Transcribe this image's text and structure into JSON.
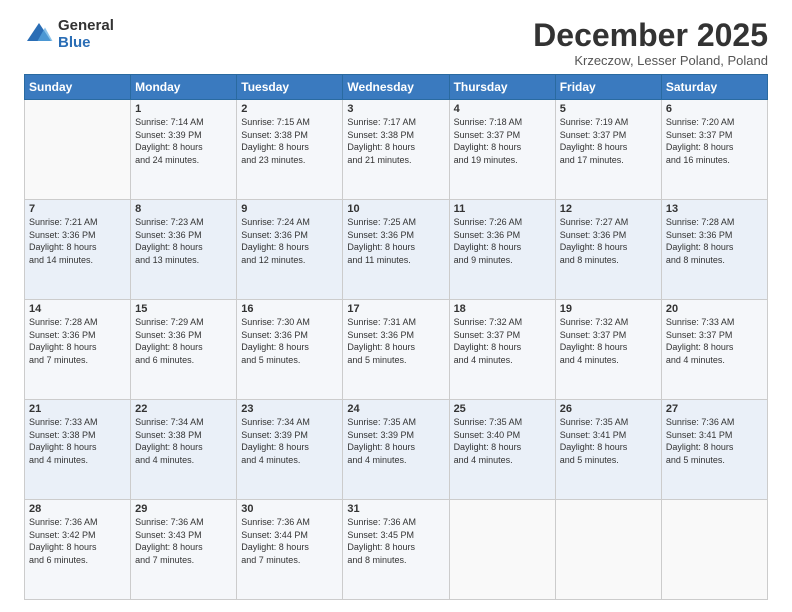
{
  "logo": {
    "general": "General",
    "blue": "Blue"
  },
  "header": {
    "month": "December 2025",
    "location": "Krzeczow, Lesser Poland, Poland"
  },
  "days": [
    "Sunday",
    "Monday",
    "Tuesday",
    "Wednesday",
    "Thursday",
    "Friday",
    "Saturday"
  ],
  "weeks": [
    [
      {
        "num": "",
        "info": ""
      },
      {
        "num": "1",
        "info": "Sunrise: 7:14 AM\nSunset: 3:39 PM\nDaylight: 8 hours\nand 24 minutes."
      },
      {
        "num": "2",
        "info": "Sunrise: 7:15 AM\nSunset: 3:38 PM\nDaylight: 8 hours\nand 23 minutes."
      },
      {
        "num": "3",
        "info": "Sunrise: 7:17 AM\nSunset: 3:38 PM\nDaylight: 8 hours\nand 21 minutes."
      },
      {
        "num": "4",
        "info": "Sunrise: 7:18 AM\nSunset: 3:37 PM\nDaylight: 8 hours\nand 19 minutes."
      },
      {
        "num": "5",
        "info": "Sunrise: 7:19 AM\nSunset: 3:37 PM\nDaylight: 8 hours\nand 17 minutes."
      },
      {
        "num": "6",
        "info": "Sunrise: 7:20 AM\nSunset: 3:37 PM\nDaylight: 8 hours\nand 16 minutes."
      }
    ],
    [
      {
        "num": "7",
        "info": "Sunrise: 7:21 AM\nSunset: 3:36 PM\nDaylight: 8 hours\nand 14 minutes."
      },
      {
        "num": "8",
        "info": "Sunrise: 7:23 AM\nSunset: 3:36 PM\nDaylight: 8 hours\nand 13 minutes."
      },
      {
        "num": "9",
        "info": "Sunrise: 7:24 AM\nSunset: 3:36 PM\nDaylight: 8 hours\nand 12 minutes."
      },
      {
        "num": "10",
        "info": "Sunrise: 7:25 AM\nSunset: 3:36 PM\nDaylight: 8 hours\nand 11 minutes."
      },
      {
        "num": "11",
        "info": "Sunrise: 7:26 AM\nSunset: 3:36 PM\nDaylight: 8 hours\nand 9 minutes."
      },
      {
        "num": "12",
        "info": "Sunrise: 7:27 AM\nSunset: 3:36 PM\nDaylight: 8 hours\nand 8 minutes."
      },
      {
        "num": "13",
        "info": "Sunrise: 7:28 AM\nSunset: 3:36 PM\nDaylight: 8 hours\nand 8 minutes."
      }
    ],
    [
      {
        "num": "14",
        "info": "Sunrise: 7:28 AM\nSunset: 3:36 PM\nDaylight: 8 hours\nand 7 minutes."
      },
      {
        "num": "15",
        "info": "Sunrise: 7:29 AM\nSunset: 3:36 PM\nDaylight: 8 hours\nand 6 minutes."
      },
      {
        "num": "16",
        "info": "Sunrise: 7:30 AM\nSunset: 3:36 PM\nDaylight: 8 hours\nand 5 minutes."
      },
      {
        "num": "17",
        "info": "Sunrise: 7:31 AM\nSunset: 3:36 PM\nDaylight: 8 hours\nand 5 minutes."
      },
      {
        "num": "18",
        "info": "Sunrise: 7:32 AM\nSunset: 3:37 PM\nDaylight: 8 hours\nand 4 minutes."
      },
      {
        "num": "19",
        "info": "Sunrise: 7:32 AM\nSunset: 3:37 PM\nDaylight: 8 hours\nand 4 minutes."
      },
      {
        "num": "20",
        "info": "Sunrise: 7:33 AM\nSunset: 3:37 PM\nDaylight: 8 hours\nand 4 minutes."
      }
    ],
    [
      {
        "num": "21",
        "info": "Sunrise: 7:33 AM\nSunset: 3:38 PM\nDaylight: 8 hours\nand 4 minutes."
      },
      {
        "num": "22",
        "info": "Sunrise: 7:34 AM\nSunset: 3:38 PM\nDaylight: 8 hours\nand 4 minutes."
      },
      {
        "num": "23",
        "info": "Sunrise: 7:34 AM\nSunset: 3:39 PM\nDaylight: 8 hours\nand 4 minutes."
      },
      {
        "num": "24",
        "info": "Sunrise: 7:35 AM\nSunset: 3:39 PM\nDaylight: 8 hours\nand 4 minutes."
      },
      {
        "num": "25",
        "info": "Sunrise: 7:35 AM\nSunset: 3:40 PM\nDaylight: 8 hours\nand 4 minutes."
      },
      {
        "num": "26",
        "info": "Sunrise: 7:35 AM\nSunset: 3:41 PM\nDaylight: 8 hours\nand 5 minutes."
      },
      {
        "num": "27",
        "info": "Sunrise: 7:36 AM\nSunset: 3:41 PM\nDaylight: 8 hours\nand 5 minutes."
      }
    ],
    [
      {
        "num": "28",
        "info": "Sunrise: 7:36 AM\nSunset: 3:42 PM\nDaylight: 8 hours\nand 6 minutes."
      },
      {
        "num": "29",
        "info": "Sunrise: 7:36 AM\nSunset: 3:43 PM\nDaylight: 8 hours\nand 7 minutes."
      },
      {
        "num": "30",
        "info": "Sunrise: 7:36 AM\nSunset: 3:44 PM\nDaylight: 8 hours\nand 7 minutes."
      },
      {
        "num": "31",
        "info": "Sunrise: 7:36 AM\nSunset: 3:45 PM\nDaylight: 8 hours\nand 8 minutes."
      },
      {
        "num": "",
        "info": ""
      },
      {
        "num": "",
        "info": ""
      },
      {
        "num": "",
        "info": ""
      }
    ]
  ]
}
